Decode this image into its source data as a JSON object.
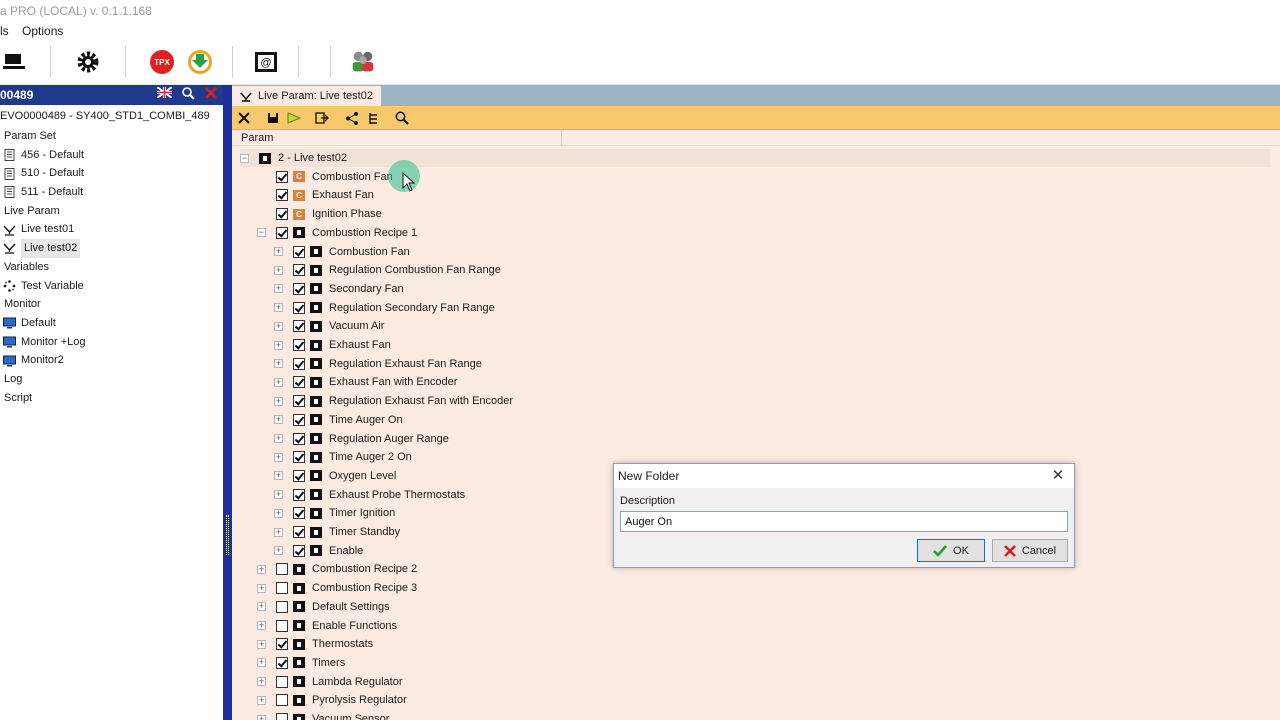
{
  "window": {
    "title": "a PRO (LOCAL) v. 0.1.1.168"
  },
  "menu": [
    "ls",
    "Options"
  ],
  "left_panel": {
    "header": "00489",
    "path": "EVO0000489 - SY400_STD1_COMBI_489",
    "tree": [
      {
        "label": "Param Set",
        "kind": "section",
        "icon": ""
      },
      {
        "label": "456 - Default",
        "kind": "item",
        "icon": "doc-icon"
      },
      {
        "label": "510 - Default",
        "kind": "item",
        "icon": "doc-icon"
      },
      {
        "label": "511 - Default",
        "kind": "item",
        "icon": "doc-icon"
      },
      {
        "label": "Live Param",
        "kind": "section",
        "icon": ""
      },
      {
        "label": "Live test01",
        "kind": "item",
        "icon": "live-icon"
      },
      {
        "label": "Live test02",
        "kind": "item",
        "icon": "live-icon",
        "selected": true
      },
      {
        "label": "Variables",
        "kind": "section",
        "icon": ""
      },
      {
        "label": "Test Variable",
        "kind": "item",
        "icon": "spinner-icon"
      },
      {
        "label": "Monitor",
        "kind": "section",
        "icon": ""
      },
      {
        "label": "Default",
        "kind": "item",
        "icon": "monitor-icon"
      },
      {
        "label": "Monitor +Log",
        "kind": "item",
        "icon": "monitor-icon"
      },
      {
        "label": "Monitor2",
        "kind": "item",
        "icon": "monitor-icon"
      },
      {
        "label": "Log",
        "kind": "section",
        "icon": ""
      },
      {
        "label": "Script",
        "kind": "section",
        "icon": ""
      }
    ]
  },
  "tab": {
    "label": "Live Param: Live test02"
  },
  "column_header": "Param",
  "param_tree": [
    {
      "label": "2 - Live test02",
      "level": 0,
      "exp": "-",
      "cb": null,
      "icon": "folder"
    },
    {
      "label": "Combustion Fan",
      "level": 1,
      "exp": "",
      "cb": true,
      "icon": "c"
    },
    {
      "label": "Exhaust Fan",
      "level": 1,
      "exp": "",
      "cb": true,
      "icon": "c"
    },
    {
      "label": "Ignition Phase",
      "level": 1,
      "exp": "",
      "cb": true,
      "icon": "c"
    },
    {
      "label": "Combustion Recipe 1",
      "level": 1,
      "exp": "-",
      "cb": true,
      "icon": "folder"
    },
    {
      "label": "Combustion Fan",
      "level": 2,
      "exp": "+",
      "cb": true,
      "icon": "folder"
    },
    {
      "label": "Regulation Combustion Fan Range",
      "level": 2,
      "exp": "+",
      "cb": true,
      "icon": "folder"
    },
    {
      "label": "Secondary Fan",
      "level": 2,
      "exp": "+",
      "cb": true,
      "icon": "folder"
    },
    {
      "label": "Regulation Secondary Fan Range",
      "level": 2,
      "exp": "+",
      "cb": true,
      "icon": "folder"
    },
    {
      "label": "Vacuum Air",
      "level": 2,
      "exp": "+",
      "cb": true,
      "icon": "folder"
    },
    {
      "label": "Exhaust Fan",
      "level": 2,
      "exp": "+",
      "cb": true,
      "icon": "folder"
    },
    {
      "label": "Regulation Exhaust Fan Range",
      "level": 2,
      "exp": "+",
      "cb": true,
      "icon": "folder"
    },
    {
      "label": "Exhaust Fan with Encoder",
      "level": 2,
      "exp": "+",
      "cb": true,
      "icon": "folder"
    },
    {
      "label": "Regulation Exhaust Fan with Encoder",
      "level": 2,
      "exp": "+",
      "cb": true,
      "icon": "folder"
    },
    {
      "label": "Time Auger On",
      "level": 2,
      "exp": "+",
      "cb": true,
      "icon": "folder"
    },
    {
      "label": "Regulation Auger Range",
      "level": 2,
      "exp": "+",
      "cb": true,
      "icon": "folder"
    },
    {
      "label": "Time Auger 2 On",
      "level": 2,
      "exp": "+",
      "cb": true,
      "icon": "folder"
    },
    {
      "label": "Oxygen Level",
      "level": 2,
      "exp": "+",
      "cb": true,
      "icon": "folder"
    },
    {
      "label": "Exhaust Probe Thermostats",
      "level": 2,
      "exp": "+",
      "cb": true,
      "icon": "folder"
    },
    {
      "label": "Timer Ignition",
      "level": 2,
      "exp": "+",
      "cb": true,
      "icon": "folder"
    },
    {
      "label": "Timer Standby",
      "level": 2,
      "exp": "+",
      "cb": true,
      "icon": "folder"
    },
    {
      "label": "Enable",
      "level": 2,
      "exp": "+",
      "cb": true,
      "icon": "folder"
    },
    {
      "label": "Combustion Recipe 2",
      "level": 1,
      "exp": "+",
      "cb": false,
      "icon": "folder"
    },
    {
      "label": "Combustion Recipe 3",
      "level": 1,
      "exp": "+",
      "cb": false,
      "icon": "folder"
    },
    {
      "label": "Default Settings",
      "level": 1,
      "exp": "+",
      "cb": false,
      "icon": "folder"
    },
    {
      "label": "Enable Functions",
      "level": 1,
      "exp": "+",
      "cb": false,
      "icon": "folder"
    },
    {
      "label": "Thermostats",
      "level": 1,
      "exp": "+",
      "cb": true,
      "icon": "folder"
    },
    {
      "label": "Timers",
      "level": 1,
      "exp": "+",
      "cb": true,
      "icon": "folder"
    },
    {
      "label": "Lambda Regulator",
      "level": 1,
      "exp": "+",
      "cb": false,
      "icon": "folder"
    },
    {
      "label": "Pyrolysis Regulator",
      "level": 1,
      "exp": "+",
      "cb": false,
      "icon": "folder"
    },
    {
      "label": "Vacuum Sensor",
      "level": 1,
      "exp": "+",
      "cb": false,
      "icon": "folder"
    }
  ],
  "dialog": {
    "title": "New Folder",
    "label": "Description",
    "value": "Auger On",
    "ok": "OK",
    "cancel": "Cancel"
  },
  "toolbar_tpx": "TPX",
  "colors": {
    "accent_blue": "#1f3a8a",
    "orange_bar": "#f7c86c",
    "panel_bg": "#fbebe2"
  }
}
